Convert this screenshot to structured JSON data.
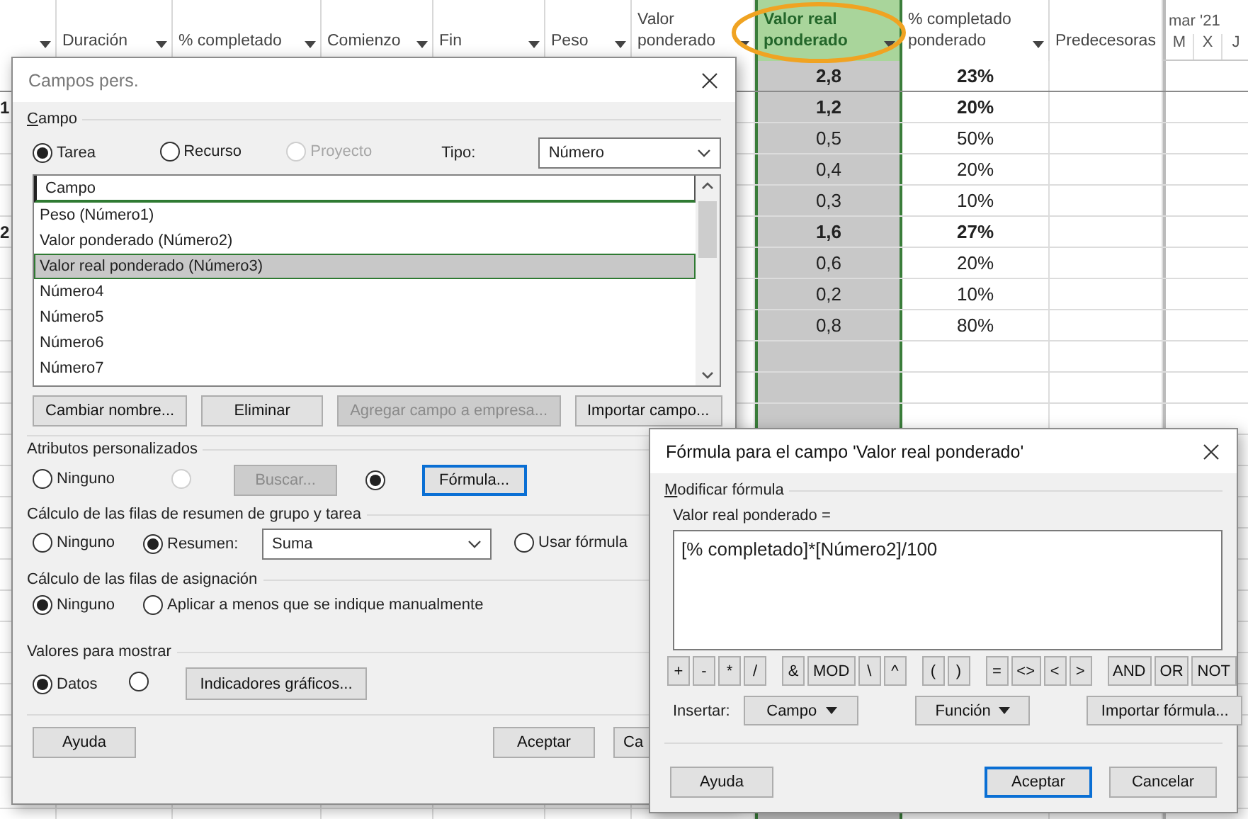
{
  "grid": {
    "columns": [
      {
        "menu": true,
        "highlighted": false
      },
      {
        "label": "Duración",
        "menu": true,
        "highlighted": false
      },
      {
        "label": "% completado",
        "menu": true,
        "highlighted": false
      },
      {
        "label": "Comienzo",
        "menu": true,
        "highlighted": false
      },
      {
        "label": "Fin",
        "menu": true,
        "highlighted": false
      },
      {
        "label": "Peso",
        "menu": true,
        "highlighted": false
      },
      {
        "label": "Valor ponderado",
        "menu": true,
        "highlighted": false
      },
      {
        "label": "Valor real ponderado",
        "menu": true,
        "highlighted": true
      },
      {
        "label": "% completado ponderado",
        "menu": true,
        "highlighted": false
      },
      {
        "label": "Predecesoras",
        "menu": false,
        "highlighted": false
      }
    ],
    "timescale": {
      "month": "mar '21",
      "days": [
        "M",
        "X",
        "J"
      ]
    },
    "rows": [
      {
        "summary": true,
        "weighted_actual": "2,8",
        "weighted_percent": "23%"
      },
      {
        "id": "1",
        "summary": true,
        "weighted_actual": "1,2",
        "weighted_percent": "20%"
      },
      {
        "summary": false,
        "weighted_actual": "0,5",
        "weighted_percent": "50%"
      },
      {
        "summary": false,
        "weighted_actual": "0,4",
        "weighted_percent": "20%"
      },
      {
        "summary": false,
        "weighted_actual": "0,3",
        "weighted_percent": "10%"
      },
      {
        "id": "2",
        "summary": true,
        "weighted_actual": "1,6",
        "weighted_percent": "27%"
      },
      {
        "summary": false,
        "weighted_actual": "0,6",
        "weighted_percent": "20%"
      },
      {
        "summary": false,
        "weighted_actual": "0,2",
        "weighted_percent": "10%"
      },
      {
        "summary": false,
        "weighted_actual": "0,8",
        "weighted_percent": "80%"
      }
    ]
  },
  "custom_fields_dialog": {
    "title": "Campos pers.",
    "field_group": {
      "label": "Campo",
      "accelerator": true,
      "scope": [
        {
          "label": "Tarea",
          "selected": true,
          "disabled": false
        },
        {
          "label": "Recurso",
          "selected": false,
          "disabled": false
        },
        {
          "label": "Proyecto",
          "selected": false,
          "disabled": true
        }
      ],
      "type_label": "Tipo:",
      "type_value": "Número",
      "list_header": "Campo",
      "items": [
        {
          "label": "Peso (Número1)",
          "selected": false
        },
        {
          "label": "Valor ponderado (Número2)",
          "selected": false
        },
        {
          "label": "Valor real ponderado (Número3)",
          "selected": true
        },
        {
          "label": "Número4",
          "selected": false
        },
        {
          "label": "Número5",
          "selected": false
        },
        {
          "label": "Número6",
          "selected": false
        },
        {
          "label": "Número7",
          "selected": false
        }
      ],
      "buttons": [
        {
          "label": "Cambiar nombre...",
          "disabled": false
        },
        {
          "label": "Eliminar",
          "disabled": false
        },
        {
          "label": "Agregar campo a empresa...",
          "disabled": true
        },
        {
          "label": "Importar campo...",
          "disabled": false
        }
      ]
    },
    "custom_attributes": {
      "label": "Atributos personalizados",
      "accelerator": false,
      "options": [
        {
          "label": "Ninguno",
          "selected": false,
          "disabled": false
        },
        {
          "selected": false,
          "disabled": true
        },
        {
          "selected": true,
          "disabled": false
        }
      ],
      "lookup_button": {
        "label": "Buscar...",
        "disabled": true
      },
      "formula_button": {
        "label": "Fórmula...",
        "focused": true
      }
    },
    "summary_calc": {
      "label": "Cálculo de las filas de resumen de grupo y tarea",
      "accelerator": false,
      "options": [
        {
          "label": "Ninguno",
          "selected": false
        },
        {
          "label": "Resumen:",
          "selected": true
        }
      ],
      "rollup": "Suma",
      "formula_option": {
        "label": "Usar fórmula",
        "selected": false
      }
    },
    "assignment_calc": {
      "label": "Cálculo de las filas de asignación",
      "accelerator": false,
      "options": [
        {
          "label": "Ninguno",
          "selected": true
        },
        {
          "label": "Aplicar a menos que se indique manualmente",
          "selected": false
        }
      ]
    },
    "display": {
      "label": "Valores para mostrar",
      "accelerator": false,
      "options": [
        {
          "label": "Datos",
          "selected": true
        },
        {
          "selected": false
        }
      ],
      "indicators_button": "Indicadores gráficos..."
    },
    "footer": [
      {
        "label": "Ayuda",
        "focused": false
      },
      {
        "label": "Aceptar",
        "focused": false
      },
      {
        "label": "Ca",
        "focused": false
      }
    ]
  },
  "formula_dialog": {
    "title": "Fórmula para el campo 'Valor real ponderado'",
    "group_label": "Modificar fórmula",
    "accelerator": true,
    "expression_label": "Valor real ponderado =",
    "expression": "[% completado]*[Número2]/100",
    "operators": [
      [
        "+",
        "-",
        "*",
        "/"
      ],
      [
        "&",
        "MOD",
        "\\",
        "^"
      ],
      [
        "(",
        ")"
      ],
      [
        "=",
        "<>",
        "<",
        ">"
      ],
      [
        "AND",
        "OR",
        "NOT"
      ]
    ],
    "insert_label": "Insertar:",
    "insert_buttons": [
      {
        "label": "Campo",
        "menu": true
      },
      {
        "label": "Función",
        "menu": true
      },
      {
        "label": "Importar fórmula...",
        "menu": false
      }
    ],
    "footer": [
      {
        "label": "Ayuda",
        "focused": false
      },
      {
        "label": "Aceptar",
        "focused": true
      },
      {
        "label": "Cancelar",
        "focused": false
      }
    ]
  }
}
